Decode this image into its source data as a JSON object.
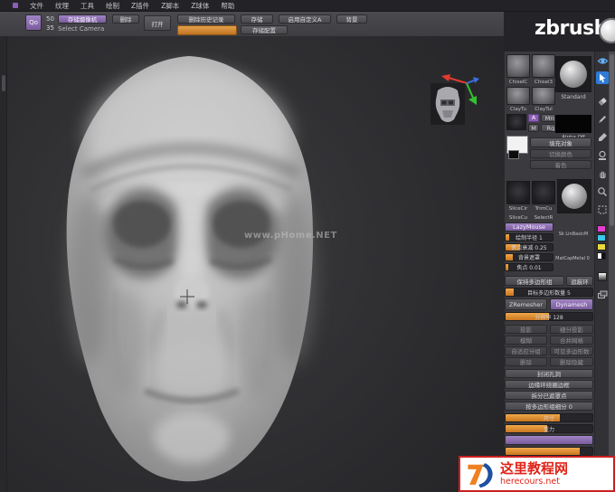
{
  "menubar": {
    "items": [
      "文件",
      "纹理",
      "工具",
      "绘制",
      "Z插件",
      "Z脚本",
      "Z球体",
      "帮助"
    ]
  },
  "toolbar": {
    "qo_icon": "Qo",
    "doc_width": "50",
    "doc_height": "35",
    "store_camera": "存储摄像机",
    "select_camera": "Select Camera",
    "delete_btn": "删除",
    "open_btn": "打开",
    "delete_history": "删除历史记录",
    "store_btn": "存储",
    "store_config": "存储配置",
    "enable_custom": "启用自定义A",
    "background_btn": "背景"
  },
  "logo": "zbrush",
  "canvas": {
    "watermark": "www.pHome.NET"
  },
  "panel": {
    "brush_row1": [
      "ChiselC",
      "Chisel3"
    ],
    "brush_row2": [
      "ClayTu",
      "ClayTul"
    ],
    "standard": "Standard",
    "a_swatch": "A",
    "mrgb": "Mrgb",
    "m": "M",
    "rgb": "Rgb",
    "alpha_off": "Alpha Off",
    "fill_object": "填充对象",
    "switch_color": "切换颜色",
    "colorize": "着色",
    "stroke_row1": [
      "SliceCir",
      "TrimCu"
    ],
    "stroke_row2": [
      "SliceCu",
      "SelectR"
    ],
    "material1": "Sk LinBasicM",
    "material2": "MatCapMetal 0",
    "lazymouse": "LazyMouse",
    "slider_draw_size": "绘制半径 1",
    "slider_focal": "焦点衰减 0.25",
    "slider_backtrack": "背景遮罩",
    "slider_focus": "焦点 0.01",
    "keep_polygroups": "保持多边形组",
    "mask_ring": "遮蔽环",
    "target_polygons": "目标多边形数量 5",
    "zremesher": "ZRemesher",
    "dynamesh": "Dynamesh",
    "resolution": "分辨率 128",
    "geo_rows": [
      [
        "投影",
        "细分投影"
      ],
      [
        "模糊",
        "合并网格"
      ],
      [
        "自适应分组",
        "可见多边形数"
      ],
      [
        "删除",
        "删除隐藏"
      ]
    ],
    "wide_buttons": [
      "封闭孔洞",
      "边缘环绕圈边框",
      "拆分已遮罩点",
      "按多边形组细分 0"
    ],
    "slider_size": "尺寸",
    "slider_gravity": "重力"
  },
  "badge": {
    "title": "这里教程网",
    "domain": "herecours.net"
  }
}
